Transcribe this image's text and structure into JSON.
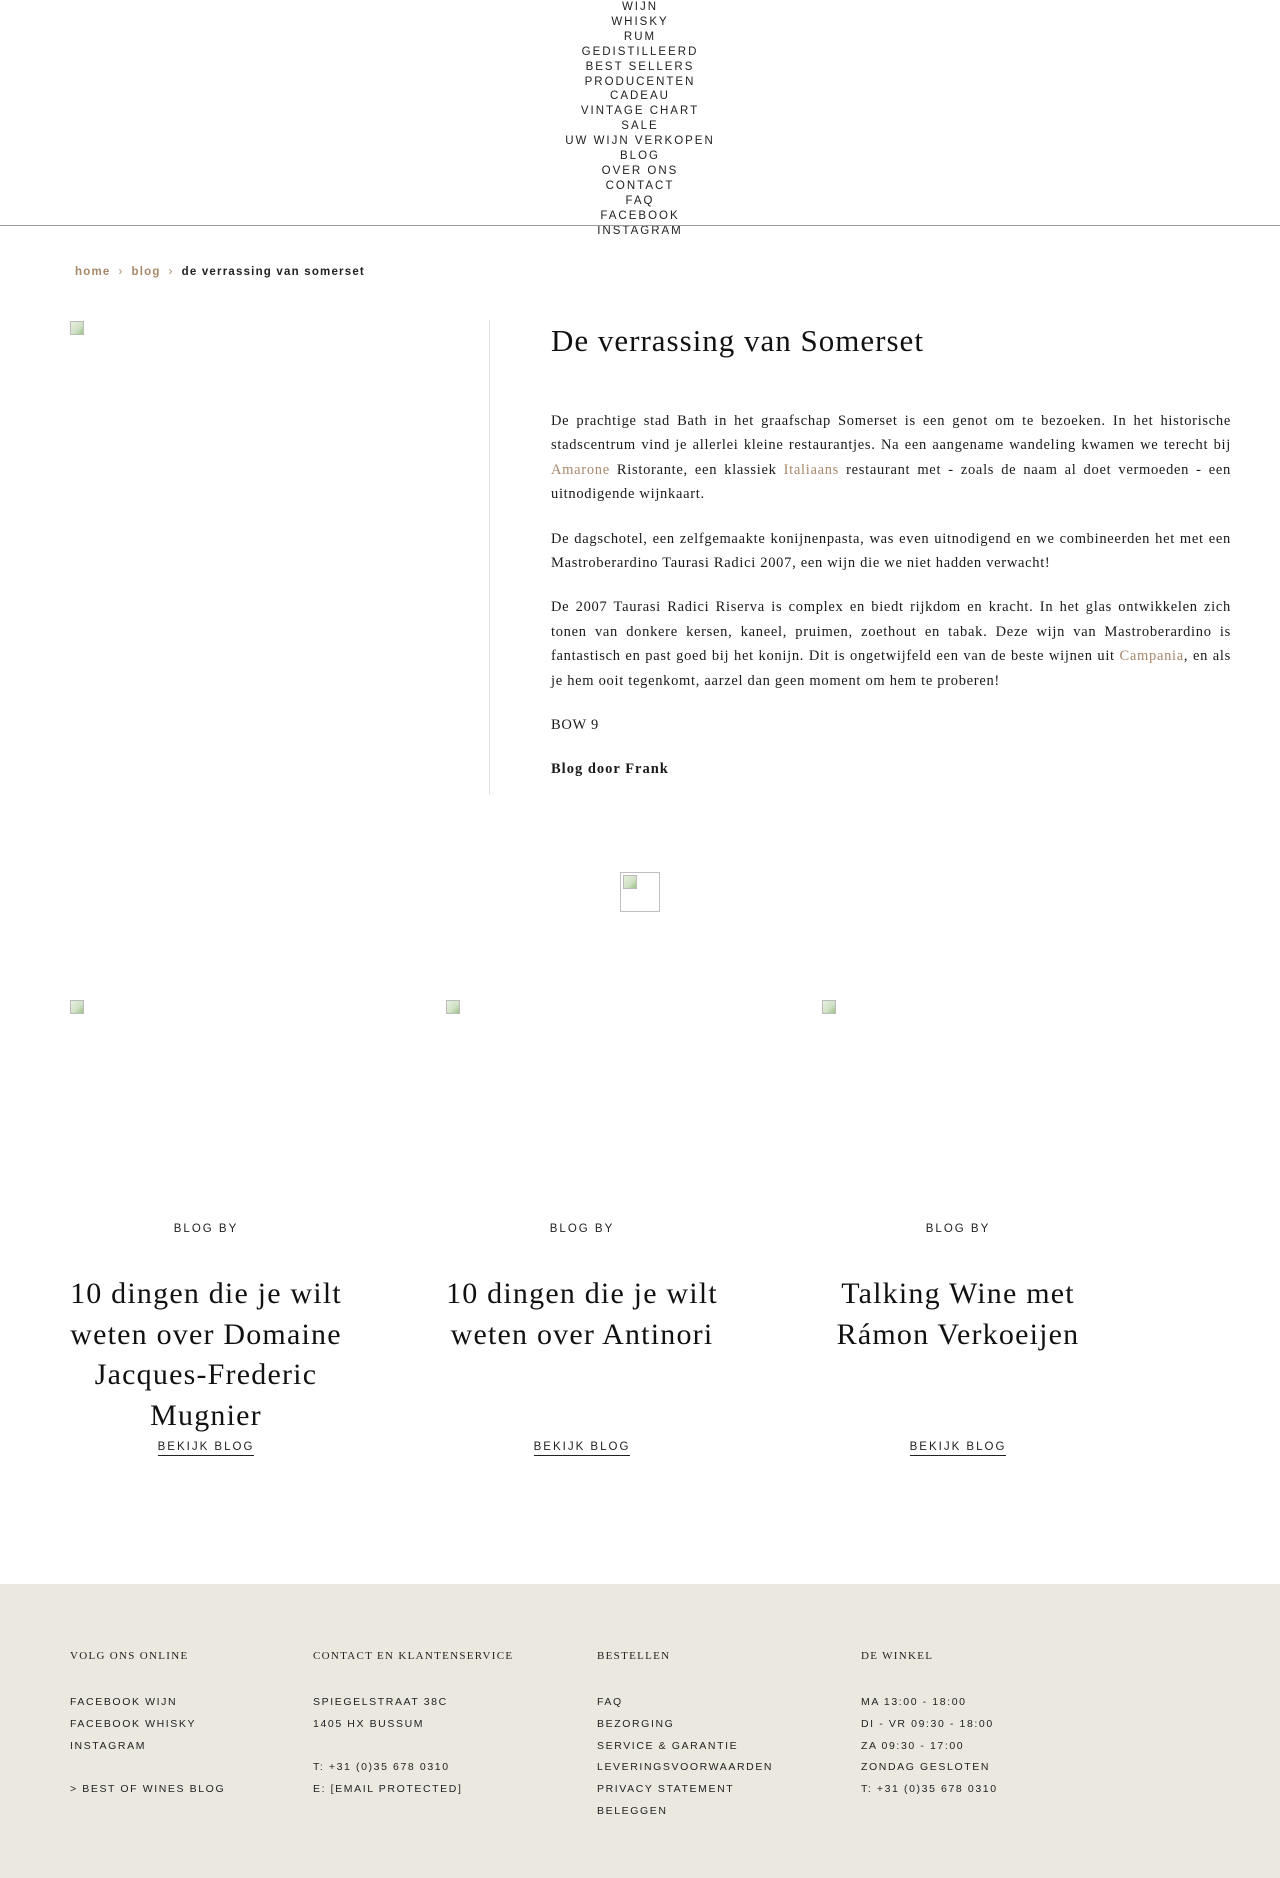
{
  "nav": {
    "items": [
      "Wijn",
      "Whisky",
      "Rum",
      "Gedistilleerd",
      "Best Sellers",
      "Producenten",
      "Cadeau",
      "Vintage Chart",
      "Sale",
      "Uw wijn verkopen",
      "Blog",
      "Over ons",
      "Contact",
      "FAQ",
      "Facebook",
      "Instagram"
    ]
  },
  "breadcrumb": {
    "home": "home",
    "blog": "blog",
    "separator": "›",
    "current": "de verrassing van somerset"
  },
  "article": {
    "title": "De verrassing van Somerset",
    "p1_a": "De prachtige stad Bath in het graafschap Somerset is een genot om te bezoeken. In het historische stadscentrum vind je allerlei kleine restaurantjes. Na een aangename wandeling kwamen we terecht bij ",
    "p1_link1": "Amarone",
    "p1_b": " Ristorante, een klassiek ",
    "p1_link2": "Italiaans",
    "p1_c": " restaurant met - zoals de naam al doet vermoeden - een uitnodigende wijnkaart.",
    "p2": "De dagschotel, een zelfgemaakte konijnenpasta, was even uitnodigend en we combineerden het met een Mastroberardino Taurasi Radici 2007, een wijn die we niet hadden verwacht!",
    "p3_a": "De 2007 Taurasi Radici Riserva is complex en biedt rijkdom en kracht. In het glas ontwikkelen zich tonen van donkere kersen, kaneel, pruimen, zoethout en tabak. Deze wijn van Mastroberardino is fantastisch en past goed bij het konijn. Dit is ongetwijfeld een van de beste wijnen uit ",
    "p3_link": "Campania",
    "p3_b": ", en als je hem ooit tegenkomt, aarzel dan geen moment om hem te proberen!",
    "score": "BOW 9",
    "author": "Blog door Frank"
  },
  "related": [
    {
      "kicker": "BLOG BY",
      "title": "10 dingen die je wilt weten over Domaine Jacques-Frederic Mugnier",
      "link": "BEKIJK BLOG"
    },
    {
      "kicker": "BLOG BY",
      "title": "10 dingen die je wilt weten over Antinori",
      "link": "BEKIJK BLOG"
    },
    {
      "kicker": "BLOG BY",
      "title": "Talking Wine met Rámon Verkoeijen",
      "link": "BEKIJK BLOG"
    }
  ],
  "footer": {
    "col1": {
      "heading": "Volg ons online",
      "items": [
        "Facebook wijn",
        "Facebook Whisky",
        "Instagram",
        "",
        "> Best of Wines Blog"
      ]
    },
    "col2": {
      "heading": "Contact en klantenservice",
      "items": [
        "Spiegelstraat 38C",
        "1405 HX Bussum",
        "",
        "T: +31 (0)35 678 0310",
        "E: [email protected]"
      ]
    },
    "col3": {
      "heading": "Bestellen",
      "items": [
        "FAQ",
        "Bezorging",
        "Service & Garantie",
        "Leveringsvoorwaarden",
        "Privacy Statement",
        "Beleggen"
      ]
    },
    "col4": {
      "heading": "De winkel",
      "items": [
        "MA 13:00 - 18:00",
        "DI - VR 09:30 - 18:00",
        "ZA 09:30 - 17:00",
        "ZONDAG GESLOTEN",
        "T: +31 (0)35 678 0310"
      ]
    }
  },
  "colors": {
    "accent_link": "#a8896a",
    "footer_bg": "#ebe8e0"
  },
  "icons": {
    "broken_image": "broken-image-icon"
  }
}
